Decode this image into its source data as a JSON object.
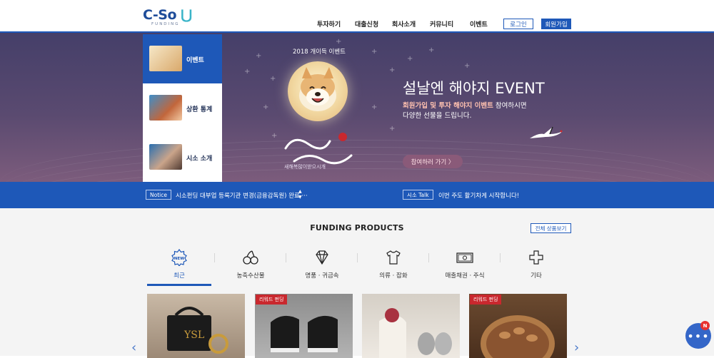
{
  "header": {
    "logo_text": "C-So",
    "logo_sub": "FUNDING",
    "nav": [
      "투자하기",
      "대출신청",
      "회사소개",
      "커뮤니티",
      "이벤트"
    ],
    "login_label": "로그인",
    "join_label": "회원가입"
  },
  "hero": {
    "side_menu": [
      {
        "label": "이벤트",
        "active": true
      },
      {
        "label": "상환 통계",
        "active": false
      },
      {
        "label": "시소 소개",
        "active": false
      }
    ],
    "arc_text": "2018 개이득 이벤트",
    "calligraphy_text": "새해복많이받으시개",
    "title": "설날엔 해야지 EVENT",
    "desc_highlight": "회원가입 및 투자 해야지 이벤트",
    "desc_line1_rest": " 참여하시면",
    "desc_line2": "다양한 선물을 드립니다.",
    "cta_label": "참여하러 가기 〉"
  },
  "notice": {
    "notice_tag": "Notice",
    "notice_text": "시소펀딩 대부업 등록기관 변경(금융감독원) 완료 ···",
    "talk_tag": "시소 Talk",
    "talk_text": "이번 주도 활기차게 시작합니다!"
  },
  "products": {
    "title": "FUNDING PRODUCTS",
    "view_all_label": "전체 상품보기",
    "categories": [
      {
        "label": "최근",
        "icon": "new-badge-icon"
      },
      {
        "label": "농축수산물",
        "icon": "cherries-icon"
      },
      {
        "label": "명품 · 귀금속",
        "icon": "diamond-icon"
      },
      {
        "label": "의류 · 잡화",
        "icon": "tshirt-icon"
      },
      {
        "label": "매출채권 · 주식",
        "icon": "banknote-icon"
      },
      {
        "label": "기타",
        "icon": "plus-icon"
      }
    ],
    "cards": [
      {
        "badge": ""
      },
      {
        "badge": "리워드 펀딩"
      },
      {
        "badge": ""
      },
      {
        "badge": "리워드 펀딩"
      }
    ]
  },
  "chat": {
    "badge": "N"
  },
  "colors": {
    "brand_blue": "#1e58b8",
    "badge_red": "#c9282e"
  }
}
